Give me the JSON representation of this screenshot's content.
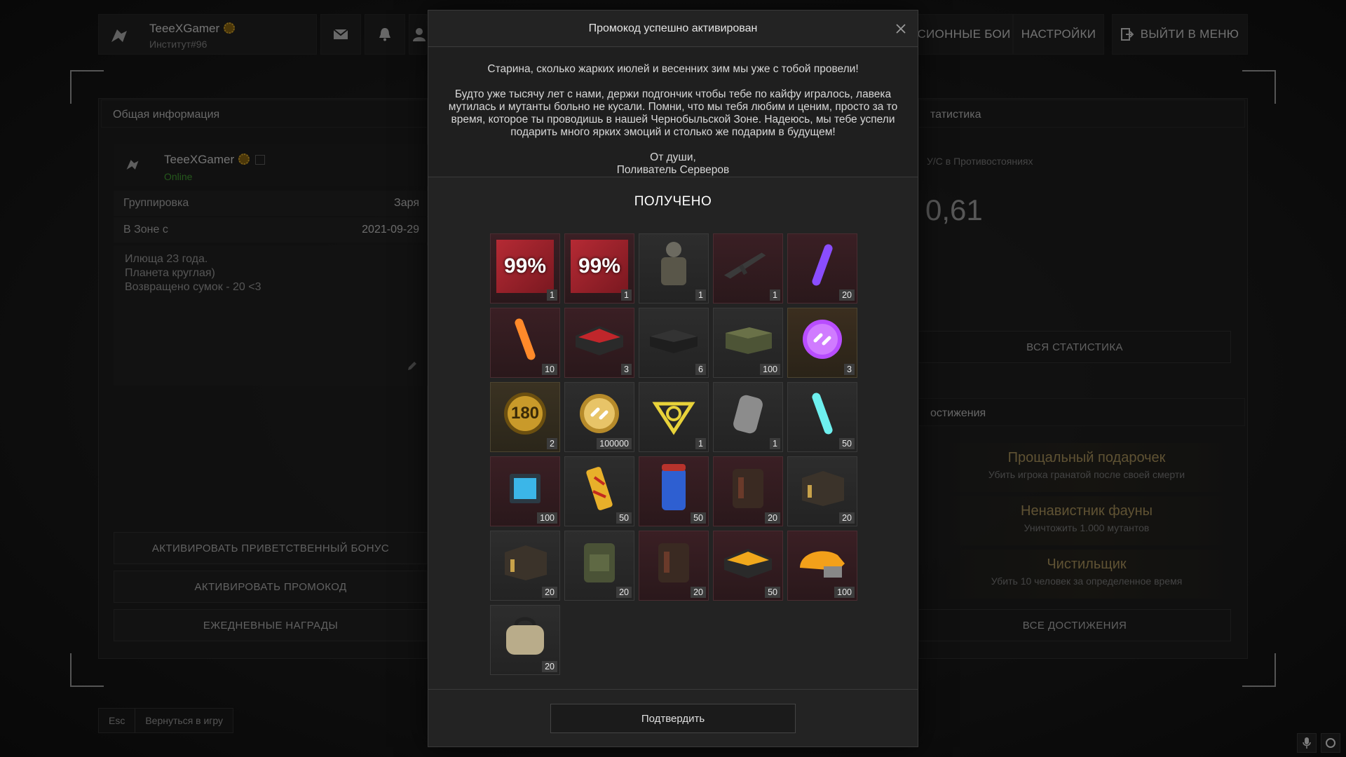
{
  "topbar": {
    "username": "TeeeXGamer",
    "subtitle": "Институт#96",
    "nav": [
      "СИОННЫЕ БОИ",
      "НАСТРОЙКИ",
      "ВЫЙТИ В МЕНЮ"
    ]
  },
  "left_panel": {
    "title": "Общая информация",
    "username": "TeeeXGamer",
    "status": "Online",
    "rows": [
      {
        "label": "Группировка",
        "value": "Заря"
      },
      {
        "label": "В Зоне с",
        "value": "2021-09-29"
      }
    ],
    "bio": [
      "Илюща 23 года.",
      "Планета круглая)",
      "Возвращено сумок - 20 <3"
    ],
    "buttons": [
      "АКТИВИРОВАТЬ ПРИВЕТСТВЕННЫЙ БОНУС",
      "АКТИВИРОВАТЬ ПРОМОКОД",
      "ЕЖЕДНЕВНЫЕ НАГРАДЫ"
    ]
  },
  "right_panel": {
    "stats_title": "татистика",
    "kd_label": "У/С в Противостояниях",
    "kd_value": "0,61",
    "all_stats": "ВСЯ СТАТИСТИКА",
    "ach_title": "остижения",
    "achievements": [
      {
        "title": "Прощальный подарочек",
        "desc": "Убить игрока гранатой после своей смерти"
      },
      {
        "title": "Ненавистник фауны",
        "desc": "Уничтожить 1.000 мутантов"
      },
      {
        "title": "Чистильщик",
        "desc": "Убить 10 человек за определенное время"
      }
    ],
    "all_ach": "ВСЕ ДОСТИЖЕНИЯ"
  },
  "footer": {
    "esc": "Esc",
    "back": "Вернуться в игру"
  },
  "modal": {
    "title": "Промокод успешно активирован",
    "line1": "Старина, сколько жарких июлей и весенних зим мы уже с тобой провели!",
    "para": "Будто уже тысячу лет с нами, держи подгончик чтобы тебе по кайфу игралось, лавека мутилась и мутанты больно не кусали. Помни, что мы тебя любим и ценим, просто за то время, которое ты проводишь в нашей Чернобыльской Зоне. Надеюсь, мы тебе успели подарить много ярких эмоций и столько же подарим в будущем!",
    "sign1": "От души,",
    "sign2": "Поливатель Серверов",
    "received": "ПОЛУЧЕНО",
    "confirm": "Подтвердить",
    "items": [
      {
        "icon": "boost-99-icon",
        "label": "99%",
        "qty": "1",
        "bg": "red"
      },
      {
        "icon": "boost-99-icon",
        "label": "99%",
        "qty": "1",
        "bg": "red"
      },
      {
        "icon": "armor-suit-icon",
        "label": "",
        "qty": "1",
        "bg": "gray"
      },
      {
        "icon": "rifle-icon",
        "label": "",
        "qty": "1",
        "bg": "red"
      },
      {
        "icon": "purple-stick-icon",
        "label": "",
        "qty": "20",
        "bg": "red"
      },
      {
        "icon": "orange-stick-icon",
        "label": "",
        "qty": "10",
        "bg": "red"
      },
      {
        "icon": "red-case-icon",
        "label": "",
        "qty": "3",
        "bg": "red"
      },
      {
        "icon": "dark-case-icon",
        "label": "",
        "qty": "6",
        "bg": "gray"
      },
      {
        "icon": "ammo-crate-icon",
        "label": "",
        "qty": "100",
        "bg": "gray"
      },
      {
        "icon": "purple-token-icon",
        "label": "",
        "qty": "3",
        "bg": "purple"
      },
      {
        "icon": "badge-180-icon",
        "label": "180",
        "qty": "2",
        "bg": "gold"
      },
      {
        "icon": "gold-coin-icon",
        "label": "",
        "qty": "100000",
        "bg": "gray"
      },
      {
        "icon": "artifact-triangle-icon",
        "label": "",
        "qty": "1",
        "bg": "gray"
      },
      {
        "icon": "dog-tag-icon",
        "label": "",
        "qty": "1",
        "bg": "gray"
      },
      {
        "icon": "cyan-stick-icon",
        "label": "",
        "qty": "50",
        "bg": "gray"
      },
      {
        "icon": "blue-battery-icon",
        "label": "",
        "qty": "100",
        "bg": "red"
      },
      {
        "icon": "yellow-grenade-icon",
        "label": "",
        "qty": "50",
        "bg": "gray"
      },
      {
        "icon": "blue-can-icon",
        "label": "",
        "qty": "50",
        "bg": "red"
      },
      {
        "icon": "backpack-red-icon",
        "label": "",
        "qty": "20",
        "bg": "red"
      },
      {
        "icon": "ammo-box-icon",
        "label": "",
        "qty": "20",
        "bg": "gray"
      },
      {
        "icon": "ammo-box-icon",
        "label": "",
        "qty": "20",
        "bg": "gray"
      },
      {
        "icon": "green-pack-icon",
        "label": "",
        "qty": "20",
        "bg": "gray"
      },
      {
        "icon": "backpack-red-icon",
        "label": "",
        "qty": "20",
        "bg": "red"
      },
      {
        "icon": "yellow-case-icon",
        "label": "",
        "qty": "50",
        "bg": "red"
      },
      {
        "icon": "orange-helmet-icon",
        "label": "",
        "qty": "100",
        "bg": "red"
      },
      {
        "icon": "bag-icon",
        "label": "",
        "qty": "20",
        "bg": "gray"
      }
    ]
  }
}
